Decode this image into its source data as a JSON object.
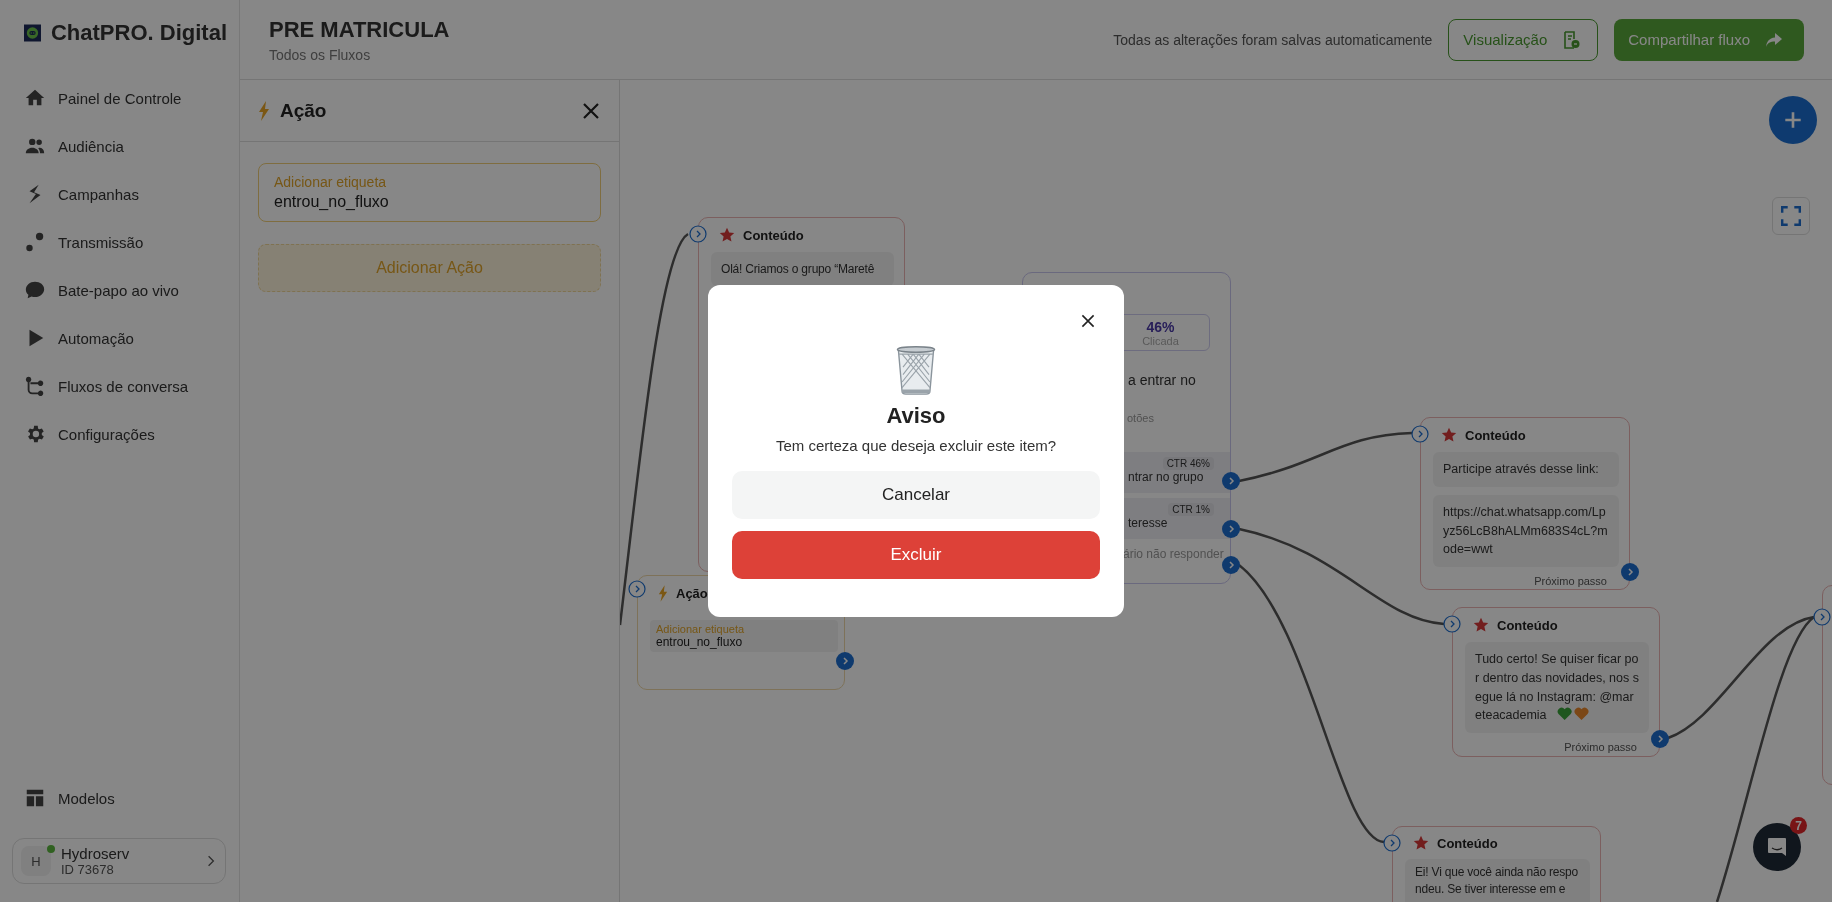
{
  "sidebar": {
    "brand": "ChatPRO. Digital",
    "items": [
      {
        "label": "Painel de Controle"
      },
      {
        "label": "Audiência"
      },
      {
        "label": "Campanhas"
      },
      {
        "label": "Transmissão"
      },
      {
        "label": "Bate-papo ao vivo"
      },
      {
        "label": "Automação"
      },
      {
        "label": "Fluxos de conversa"
      },
      {
        "label": "Configurações"
      }
    ],
    "bottom_items": [
      {
        "label": "Modelos"
      }
    ],
    "account": {
      "initial": "H",
      "name": "Hydroserv",
      "id": "ID 73678",
      "online": true
    }
  },
  "header": {
    "title": "PRE MATRICULA",
    "breadcrumb": "Todos os Fluxos",
    "save_status": "Todas as alterações foram salvas automaticamente",
    "buttons": [
      {
        "label": "Visualização",
        "kind": "outline"
      },
      {
        "label": "Compartilhar fluxo",
        "kind": "primary"
      }
    ]
  },
  "action_panel": {
    "title": "Ação",
    "field": {
      "label": "Adicionar etiqueta",
      "value": "entrou_no_fluxo"
    },
    "add_button": "Adicionar Ação"
  },
  "canvas": {
    "nodes": [
      {
        "kind": "content",
        "title": "Conteúdo",
        "messages": [
          {
            "text": "Olá! Criamos o grupo “Maretê",
            "hearts": false
          }
        ]
      },
      {
        "kind": "buttons",
        "stat": {
          "value": "46%",
          "label": "Clicada"
        },
        "text": "a entrar no",
        "section_label": "otões",
        "options": [
          {
            "ctr": "CTR 46%",
            "label": "ntrar no grupo"
          },
          {
            "ctr": "CTR 1%",
            "label": "teresse"
          }
        ],
        "fallback": "ário não responder"
      },
      {
        "kind": "content",
        "title": "Conteúdo",
        "messages": [
          {
            "text": "Participe através desse link:",
            "hearts": false
          },
          {
            "text": "https://chat.whatsapp.com/Lpyz56LcB8hALMm683S4cL?mode=wwt",
            "hearts": false
          }
        ],
        "footer": "Próximo passo"
      },
      {
        "kind": "content",
        "title": "Conteúdo",
        "messages": [
          {
            "text": "Tudo certo! Se quiser ficar por dentro das novidades, nos segue lá no Instagram: @mareteacademia",
            "hearts": true
          }
        ],
        "footer": "Próximo passo"
      },
      {
        "kind": "content",
        "title": "Conteúdo",
        "messages": [
          {
            "text": "Ei! Vi que você ainda não respondeu. Se tiver interesse em e",
            "hearts": false
          }
        ]
      },
      {
        "kind": "action",
        "title": "Ação",
        "field_label": "Adicionar etiqueta",
        "field_value": "entrou_no_fluxo"
      }
    ],
    "chat_launcher": {
      "badge": "7"
    }
  },
  "dialog": {
    "title": "Aviso",
    "message": "Tem certeza que deseja excluir este item?",
    "buttons": [
      {
        "label": "Cancelar",
        "kind": "secondary"
      },
      {
        "label": "Excluir",
        "kind": "danger"
      }
    ]
  }
}
